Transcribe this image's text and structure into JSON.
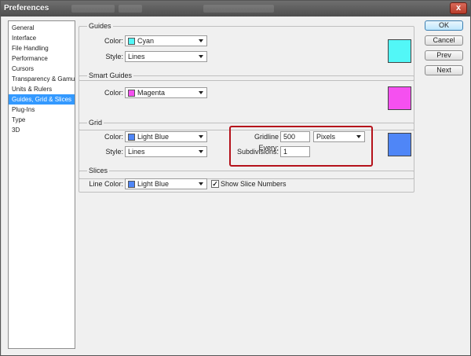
{
  "window": {
    "title": "Preferences",
    "close_glyph": "x"
  },
  "colors": {
    "cyan": "#52f7f7",
    "magenta": "#f550f0",
    "light_blue": "#4f86f7",
    "selection": "#3399ff",
    "highlight": "#b5121b"
  },
  "sidebar": {
    "items": [
      {
        "label": "General"
      },
      {
        "label": "Interface"
      },
      {
        "label": "File Handling"
      },
      {
        "label": "Performance"
      },
      {
        "label": "Cursors"
      },
      {
        "label": "Transparency & Gamut"
      },
      {
        "label": "Units & Rulers"
      },
      {
        "label": "Guides, Grid & Slices"
      },
      {
        "label": "Plug-Ins"
      },
      {
        "label": "Type"
      },
      {
        "label": "3D"
      }
    ]
  },
  "guides": {
    "title": "Guides",
    "color_label": "Color:",
    "color_value": "Cyan",
    "style_label": "Style:",
    "style_value": "Lines"
  },
  "smart_guides": {
    "title": "Smart Guides",
    "color_label": "Color:",
    "color_value": "Magenta"
  },
  "grid": {
    "title": "Grid",
    "color_label": "Color:",
    "color_value": "Light Blue",
    "style_label": "Style:",
    "style_value": "Lines",
    "gridline_label": "Gridline Every:",
    "gridline_value": "500",
    "unit_value": "Pixels",
    "subdivisions_label": "Subdivisions:",
    "subdivisions_value": "1"
  },
  "slices": {
    "title": "Slices",
    "line_color_label": "Line Color:",
    "line_color_value": "Light Blue",
    "show_numbers_label": "Show Slice Numbers",
    "show_numbers_checked": true,
    "check_glyph": "✓"
  },
  "buttons": {
    "ok": "OK",
    "cancel": "Cancel",
    "prev": "Prev",
    "next": "Next"
  }
}
